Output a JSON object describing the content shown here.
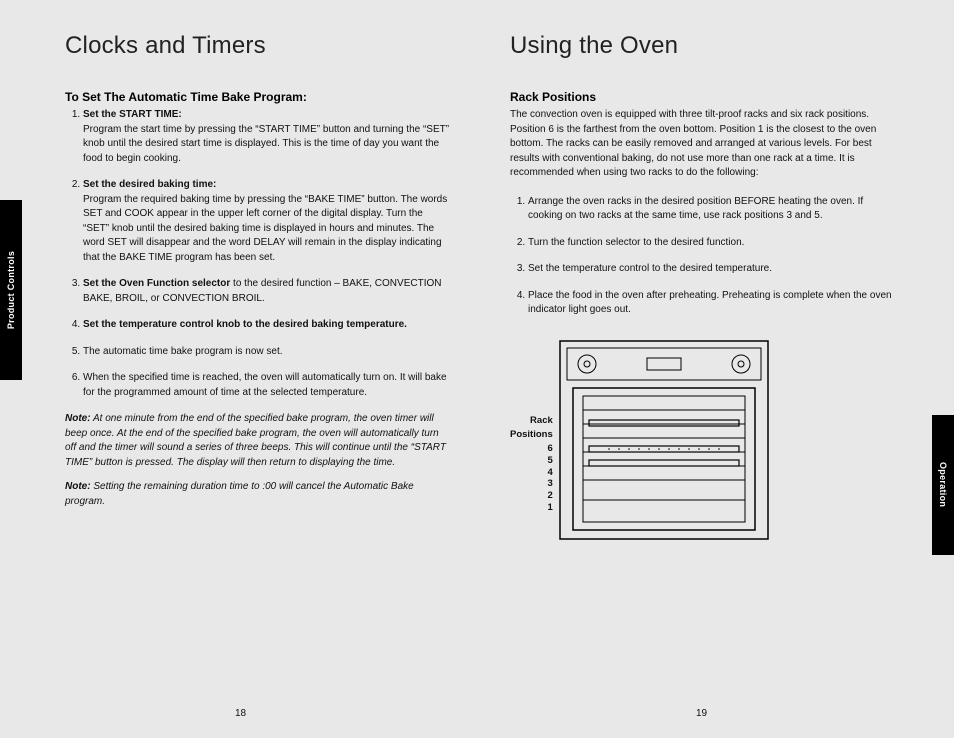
{
  "tabs": {
    "left": "Product Controls",
    "right": "Operation"
  },
  "left": {
    "title": "Clocks and Timers",
    "subtitle": "To Set The Automatic Time Bake Program:",
    "steps": [
      {
        "head": "Set the START TIME:",
        "body": "Program the start time by pressing the “START TIME” button and turning the “SET” knob until the desired start time is displayed. This is the time of day you want the food to begin cooking."
      },
      {
        "head": "Set the desired baking time:",
        "body": "Program the required baking time by pressing the “BAKE TIME” button. The words SET and COOK appear in the upper left corner of the digital display. Turn the “SET” knob until the desired baking time is displayed in hours and minutes. The word SET will disappear and the word DELAY will remain in the display indicating that the BAKE TIME program has been set."
      },
      {
        "head": "Set the Oven Function selector",
        "tail": " to the desired function – BAKE, CONVECTION BAKE, BROIL, or CONVECTION BROIL."
      },
      {
        "head": "Set the temperature control knob to the desired baking temperature."
      },
      {
        "plain": "The automatic time bake program is now set."
      },
      {
        "plain": "When the specified time is reached, the oven will automatically turn on. It will bake for the programmed amount of time at the selected temperature."
      }
    ],
    "note1": "At one minute from the end of the specified bake program, the oven timer will beep once. At the end of the specified bake program, the oven will automatically turn off and the timer will sound a series of three beeps. This will continue until the “START TIME” button is pressed. The display will then return to displaying the time.",
    "note2": "Setting the remaining duration time to :00 will cancel the Automatic Bake program.",
    "noteLabel": "Note:"
  },
  "right": {
    "title": "Using the Oven",
    "subtitle": "Rack Positions",
    "intro": "The convection oven is equipped with three tilt-proof racks and six rack positions. Position 6 is the farthest from the oven bottom. Position 1 is the closest to the oven bottom. The racks can be easily removed and arranged at various levels. For best results with conventional baking, do not use more than one rack at a time. It is recommended when using two racks to do the following:",
    "steps": [
      {
        "plain": "Arrange the oven racks in the desired position BEFORE heating the oven. If cooking on two racks at the same time, use rack positions 3 and 5."
      },
      {
        "plain": "Turn the function selector to the desired function."
      },
      {
        "plain": "Set the temperature control to the desired temperature."
      },
      {
        "plain": "Place the food in the oven after preheating. Preheating is complete when the oven indicator light goes out."
      }
    ],
    "diagram": {
      "labelTitle1": "Rack",
      "labelTitle2": "Positions",
      "nums": [
        "6",
        "5",
        "4",
        "3",
        "2",
        "1"
      ]
    }
  },
  "pages": {
    "left": "18",
    "right": "19"
  }
}
